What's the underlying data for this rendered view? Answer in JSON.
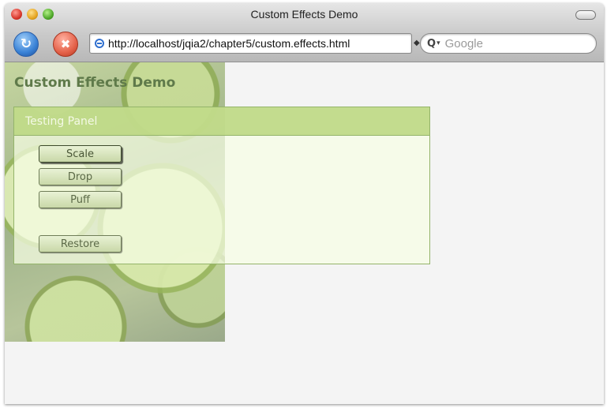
{
  "window": {
    "title": "Custom Effects Demo"
  },
  "toolbar": {
    "url": "http://localhost/jqia2/chapter5/custom.effects.html",
    "search_placeholder": "Google",
    "reload_icon": "reload-icon",
    "stop_icon": "stop-icon",
    "site_icon": "globe-icon",
    "search_icon": "search-icon"
  },
  "page": {
    "title": "Custom Effects Demo",
    "panel": {
      "title": "Testing Panel",
      "buttons": [
        {
          "label": "Scale"
        },
        {
          "label": "Drop"
        },
        {
          "label": "Puff"
        },
        {
          "label": "Restore"
        }
      ]
    }
  },
  "colors": {
    "accent_green": "#94b46a",
    "panel_header": "#bad67e",
    "title_green": "#5f7a4a"
  }
}
